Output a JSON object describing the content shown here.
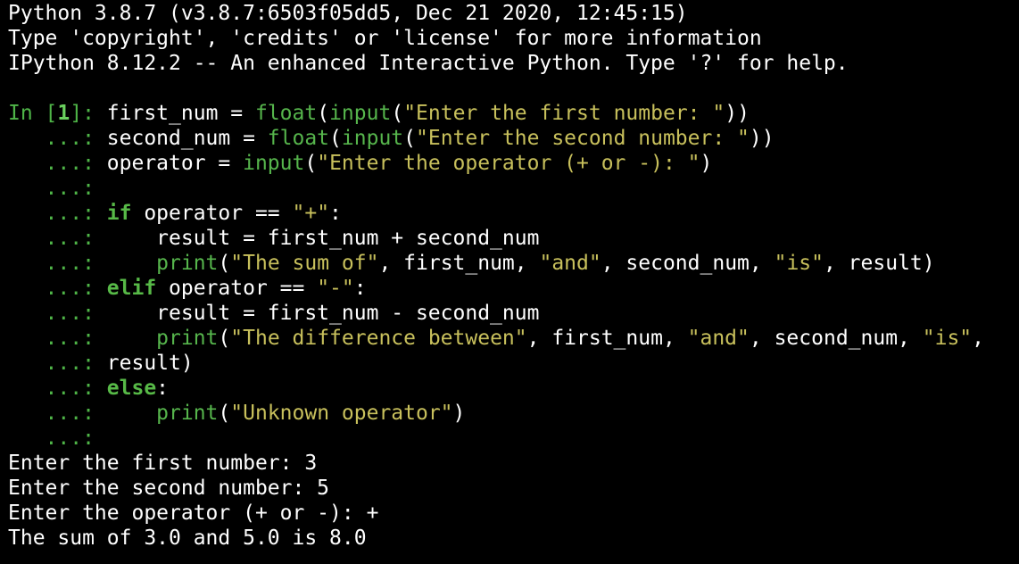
{
  "banner": [
    "Python 3.8.7 (v3.8.7:6503f05dd5, Dec 21 2020, 12:45:15)",
    "Type 'copyright', 'credits' or 'license' for more information",
    "IPython 8.12.2 -- An enhanced Interactive Python. Type '?' for help."
  ],
  "prompt": {
    "in_label": "In [",
    "number": "1",
    "in_close": "]: ",
    "continuation": "   ...: "
  },
  "code": {
    "l1": {
      "a": "first_num = ",
      "fn": "float",
      "b": "(",
      "fn2": "input",
      "c": "(",
      "s": "\"Enter the first number: \"",
      "d": "))"
    },
    "l2": {
      "a": "second_num = ",
      "fn": "float",
      "b": "(",
      "fn2": "input",
      "c": "(",
      "s": "\"Enter the second number: \"",
      "d": "))"
    },
    "l3": {
      "a": "operator = ",
      "fn": "input",
      "b": "(",
      "s": "\"Enter the operator (+ or -): \"",
      "d": ")"
    },
    "l5": {
      "kw": "if",
      "a": " operator == ",
      "s": "\"+\"",
      "d": ":"
    },
    "l6": {
      "a": "    result = first_num + second_num"
    },
    "l7": {
      "indent": "    ",
      "fn": "print",
      "b": "(",
      "s1": "\"The sum of\"",
      "m1": ", first_num, ",
      "s2": "\"and\"",
      "m2": ", second_num, ",
      "s3": "\"is\"",
      "d": ", result)"
    },
    "l8": {
      "kw": "elif",
      "a": " operator == ",
      "s": "\"-\"",
      "d": ":"
    },
    "l9": {
      "a": "    result = first_num - second_num"
    },
    "l10": {
      "indent": "    ",
      "fn": "print",
      "b": "(",
      "s1": "\"The difference between\"",
      "m1": ", first_num, ",
      "s2": "\"and\"",
      "m2": ", second_num, ",
      "s3": "\"is\"",
      "d": ","
    },
    "l11": {
      "a": "result)"
    },
    "l12": {
      "kw": "else",
      "d": ":"
    },
    "l13": {
      "indent": "    ",
      "fn": "print",
      "b": "(",
      "s": "\"Unknown operator\"",
      "d": ")"
    }
  },
  "output": [
    "Enter the first number: 3",
    "Enter the second number: 5",
    "Enter the operator (+ or -): +",
    "The sum of 3.0 and 5.0 is 8.0"
  ],
  "colors": {
    "background": "#000000",
    "text": "#ffffff",
    "prompt": "#4fb548",
    "string": "#c8c05c",
    "keyword": "#57b947"
  }
}
